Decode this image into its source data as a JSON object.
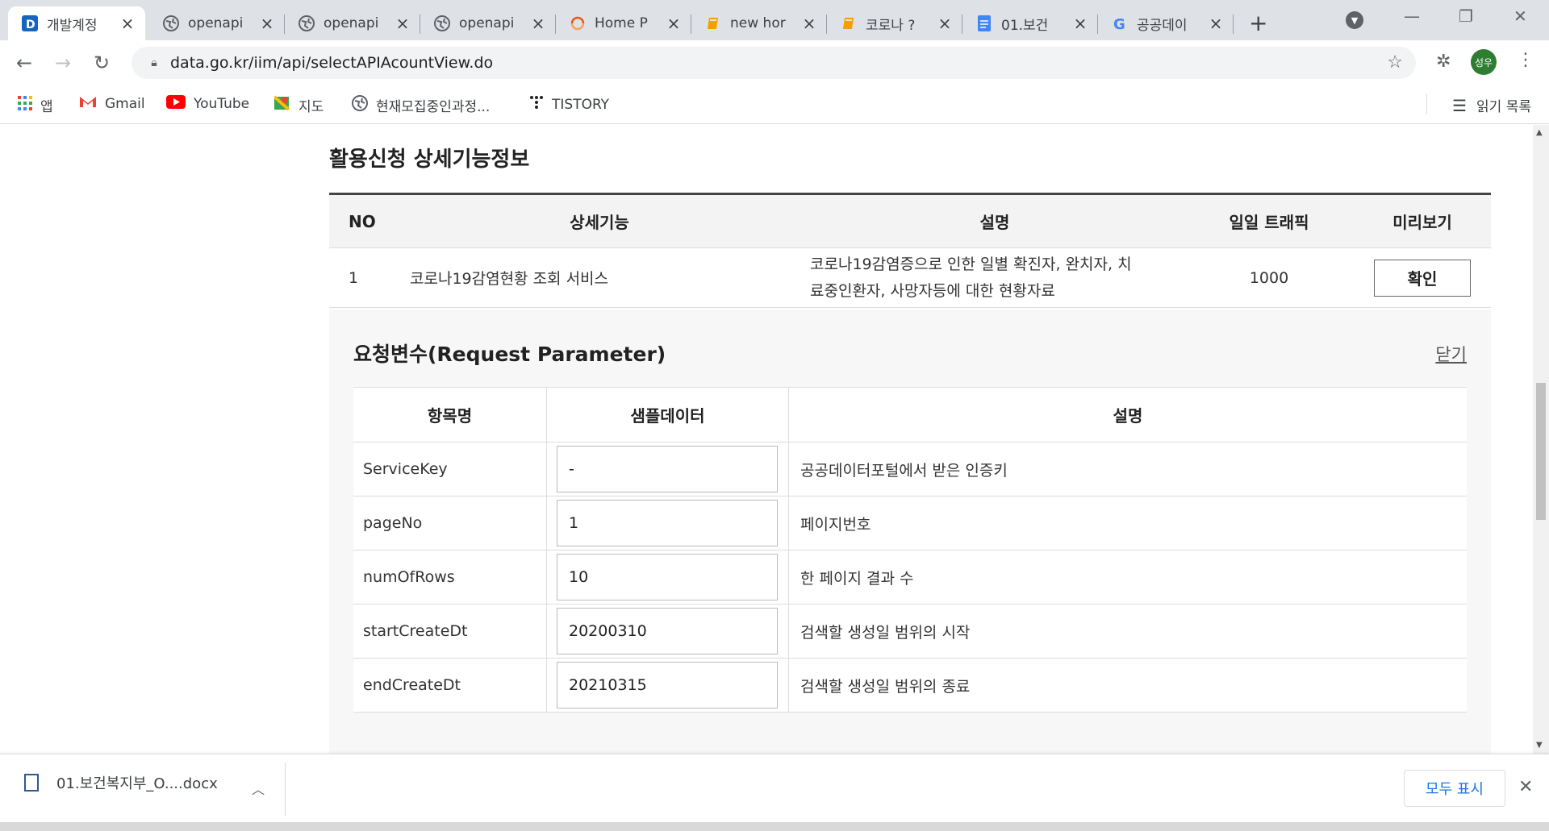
{
  "browser": {
    "tabs": [
      {
        "title": "개발계정",
        "icon": "data-portal-icon"
      },
      {
        "title": "openapi",
        "icon": "globe-icon"
      },
      {
        "title": "openapi",
        "icon": "globe-icon"
      },
      {
        "title": "openapi",
        "icon": "globe-icon"
      },
      {
        "title": "Home P",
        "icon": "swirl-icon"
      },
      {
        "title": "new hor",
        "icon": "book-icon"
      },
      {
        "title": "코로나 ?",
        "icon": "book-icon"
      },
      {
        "title": "01.보건",
        "icon": "docs-icon"
      },
      {
        "title": "공공데이",
        "icon": "google-icon"
      }
    ],
    "url": "data.go.kr/iim/api/selectAPIAcountView.do",
    "profile_label": "성우",
    "bookmarks": [
      {
        "label": "앱",
        "icon": "apps-grid-icon"
      },
      {
        "label": "Gmail",
        "icon": "gmail-icon"
      },
      {
        "label": "YouTube",
        "icon": "youtube-icon"
      },
      {
        "label": "지도",
        "icon": "maps-icon"
      },
      {
        "label": "현재모집중인과정...",
        "icon": "globe-icon"
      },
      {
        "label": "TISTORY",
        "icon": "tistory-icon"
      }
    ],
    "reading_list": "읽기 목록"
  },
  "page": {
    "section_title": "활용신청 상세기능정보",
    "main_table": {
      "headers": {
        "no": "NO",
        "func": "상세기능",
        "desc": "설명",
        "traffic": "일일 트래픽",
        "preview": "미리보기"
      },
      "rows": [
        {
          "no": "1",
          "func": "코로나19감염현황 조회 서비스",
          "desc_line1": "코로나19감염증으로 인한 일별 확진자, 완치자, 치",
          "desc_line2": "료중인환자, 사망자등에 대한 현황자료",
          "traffic": "1000",
          "button": "확인"
        }
      ]
    },
    "request": {
      "title": "요청변수(Request Parameter)",
      "close": "닫기",
      "headers": {
        "name": "항목명",
        "sample": "샘플데이터",
        "desc": "설명"
      },
      "rows": [
        {
          "name": "ServiceKey",
          "sample": "-",
          "desc": "공공데이터포털에서 받은 인증키"
        },
        {
          "name": "pageNo",
          "sample": "1",
          "desc": "페이지번호"
        },
        {
          "name": "numOfRows",
          "sample": "10",
          "desc": "한 페이지 결과 수"
        },
        {
          "name": "startCreateDt",
          "sample": "20200310",
          "desc": "검색할 생성일 범위의 시작"
        },
        {
          "name": "endCreateDt",
          "sample": "20210315",
          "desc": "검색할 생성일 범위의 종료"
        }
      ]
    }
  },
  "downloads": {
    "file": "01.보건복지부_O....docx",
    "show_all": "모두 표시"
  }
}
